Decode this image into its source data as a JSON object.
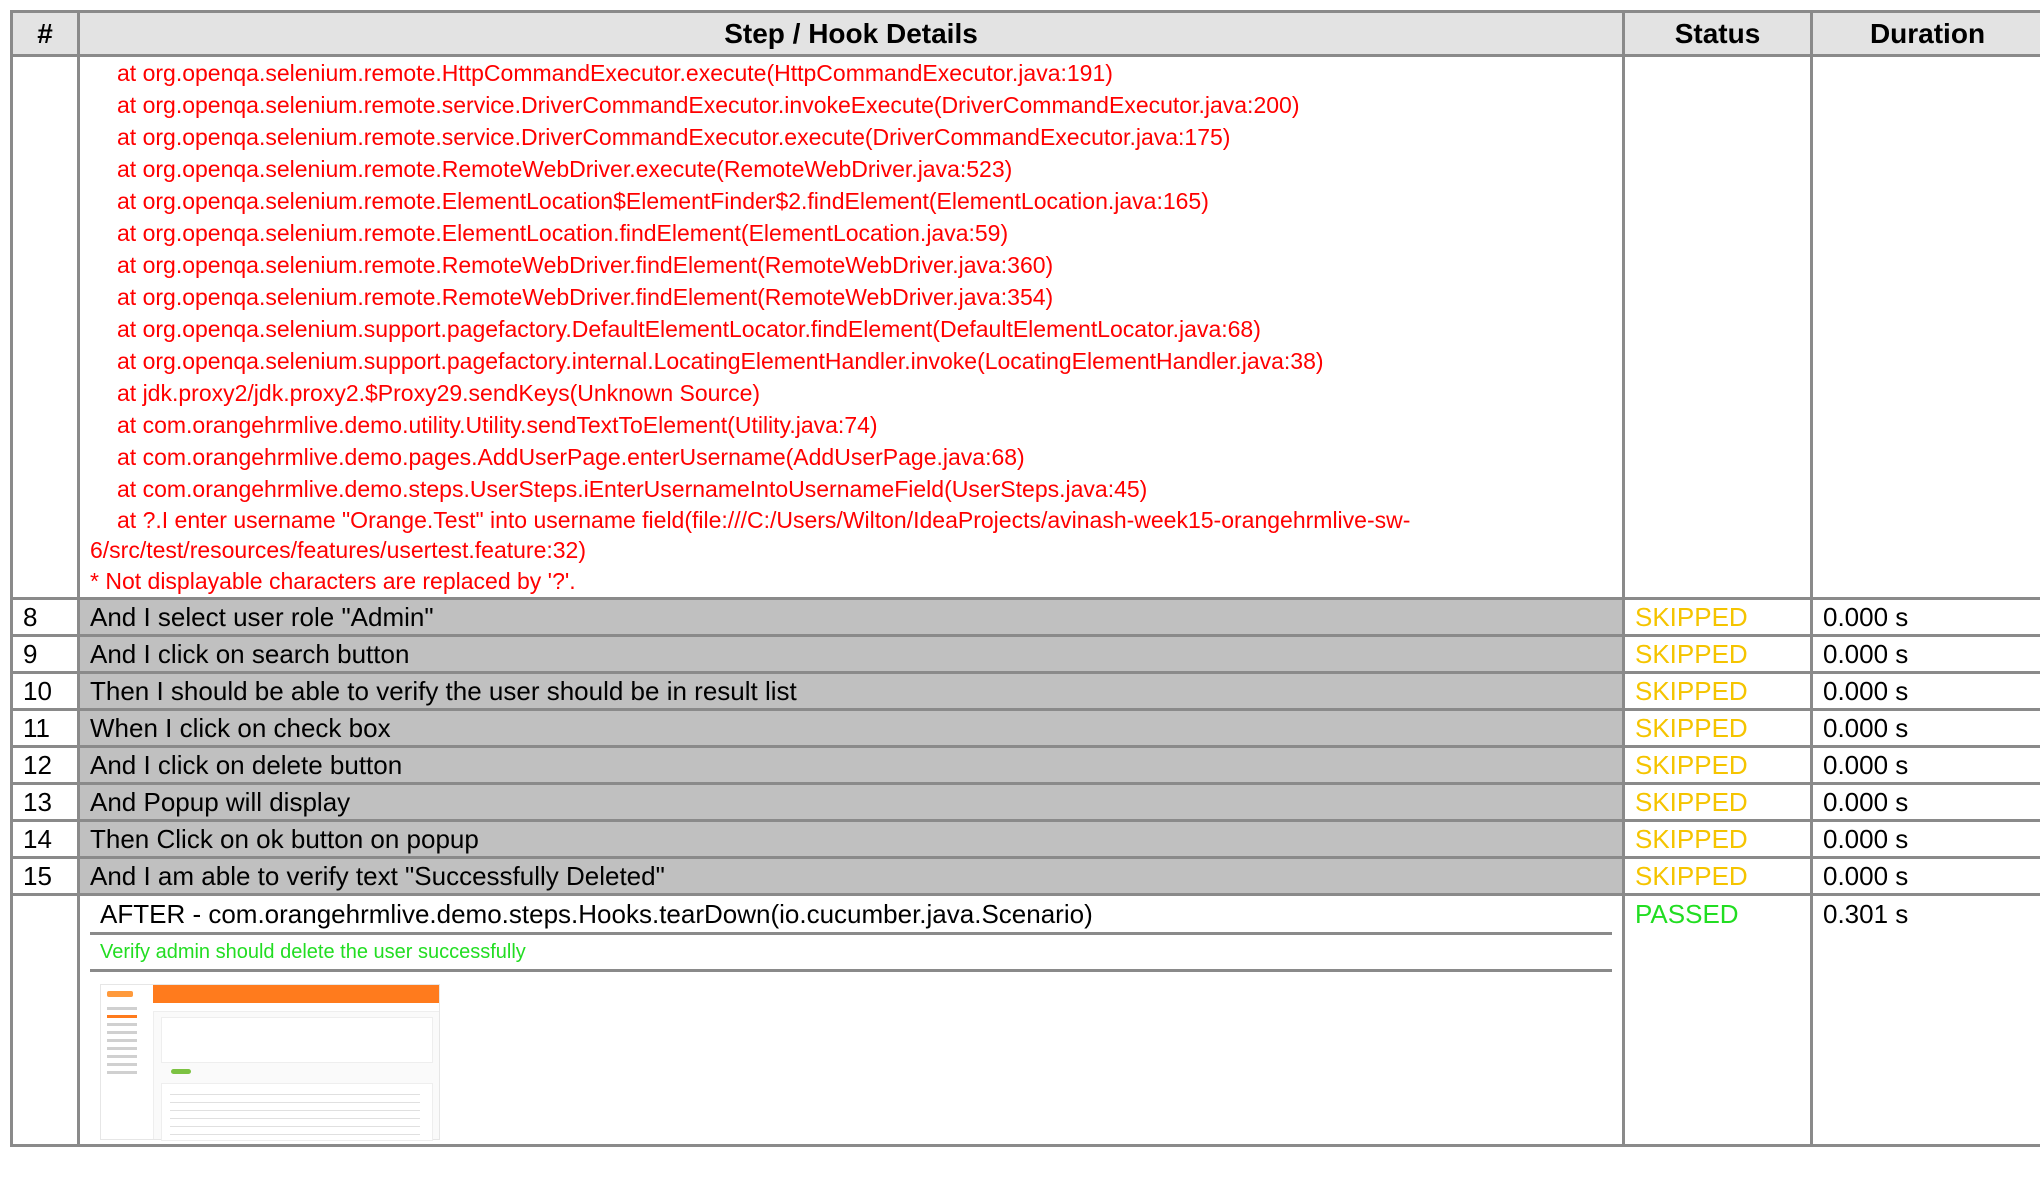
{
  "table": {
    "headers": {
      "num": "#",
      "details": "Step / Hook Details",
      "status": "Status",
      "duration": "Duration"
    }
  },
  "trace": {
    "lines": [
      "at org.openqa.selenium.remote.HttpCommandExecutor.execute(HttpCommandExecutor.java:191)",
      "at org.openqa.selenium.remote.service.DriverCommandExecutor.invokeExecute(DriverCommandExecutor.java:200)",
      "at org.openqa.selenium.remote.service.DriverCommandExecutor.execute(DriverCommandExecutor.java:175)",
      "at org.openqa.selenium.remote.RemoteWebDriver.execute(RemoteWebDriver.java:523)",
      "at org.openqa.selenium.remote.ElementLocation$ElementFinder$2.findElement(ElementLocation.java:165)",
      "at org.openqa.selenium.remote.ElementLocation.findElement(ElementLocation.java:59)",
      "at org.openqa.selenium.remote.RemoteWebDriver.findElement(RemoteWebDriver.java:360)",
      "at org.openqa.selenium.remote.RemoteWebDriver.findElement(RemoteWebDriver.java:354)",
      "at org.openqa.selenium.support.pagefactory.DefaultElementLocator.findElement(DefaultElementLocator.java:68)",
      "at org.openqa.selenium.support.pagefactory.internal.LocatingElementHandler.invoke(LocatingElementHandler.java:38)",
      "at jdk.proxy2/jdk.proxy2.$Proxy29.sendKeys(Unknown Source)",
      "at com.orangehrmlive.demo.utility.Utility.sendTextToElement(Utility.java:74)",
      "at com.orangehrmlive.demo.pages.AddUserPage.enterUsername(AddUserPage.java:68)",
      "at com.orangehrmlive.demo.steps.UserSteps.iEnterUsernameIntoUsernameField(UserSteps.java:45)"
    ],
    "last_line": "at ?.I enter username \"Orange.Test\" into username field(file:///C:/Users/Wilton/IdeaProjects/avinash-week15-orangehrmlive-sw-6/src/test/resources/features/usertest.feature:32)",
    "note": "* Not displayable characters are replaced by '?'."
  },
  "steps": [
    {
      "num": "8",
      "text": "And I select user role \"Admin\"",
      "status": "SKIPPED",
      "duration": "0.000 s"
    },
    {
      "num": "9",
      "text": "And I click on search button",
      "status": "SKIPPED",
      "duration": "0.000 s"
    },
    {
      "num": "10",
      "text": "Then I should be able to verify the user should be in result list",
      "status": "SKIPPED",
      "duration": "0.000 s"
    },
    {
      "num": "11",
      "text": "When I click on check box",
      "status": "SKIPPED",
      "duration": "0.000 s"
    },
    {
      "num": "12",
      "text": "And I click on delete button",
      "status": "SKIPPED",
      "duration": "0.000 s"
    },
    {
      "num": "13",
      "text": "And Popup will display",
      "status": "SKIPPED",
      "duration": "0.000 s"
    },
    {
      "num": "14",
      "text": "Then Click on ok button on popup",
      "status": "SKIPPED",
      "duration": "0.000 s"
    },
    {
      "num": "15",
      "text": "And I am able to verify text \"Successfully Deleted\"",
      "status": "SKIPPED",
      "duration": "0.000 s"
    }
  ],
  "after_hook": {
    "title": "AFTER - com.orangehrmlive.demo.steps.Hooks.tearDown(io.cucumber.java.Scenario)",
    "status": "PASSED",
    "duration": "0.301 s",
    "message": "Verify admin should delete the user successfully",
    "screenshot_icon": "screenshot-thumbnail"
  },
  "colors": {
    "error": "#ff0000",
    "skipped": "#f5c400",
    "passed": "#22dd22",
    "step_bg": "#c0c0c0",
    "border": "#8a8a8a"
  }
}
